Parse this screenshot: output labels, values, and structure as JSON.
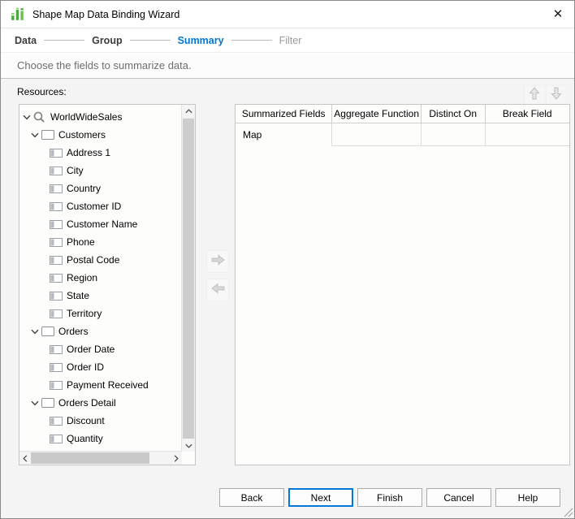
{
  "window": {
    "title": "Shape Map Data Binding Wizard"
  },
  "icons": {
    "close": "✕"
  },
  "colors": {
    "accent_blue": "#0078d7",
    "icon_green_dark": "#49a83e",
    "icon_green_light": "#8fd07f",
    "content_background": "#f3f4f3",
    "panel_background": "#fdfdfc",
    "panel_border": "#c6c6c6"
  },
  "steps": {
    "items": [
      {
        "label": "Data",
        "state": "done"
      },
      {
        "label": "Group",
        "state": "done"
      },
      {
        "label": "Summary",
        "state": "active"
      },
      {
        "label": "Filter",
        "state": "upcoming"
      }
    ]
  },
  "subtitle": "Choose the fields to summarize data.",
  "resources": {
    "label": "Resources:",
    "tree": [
      {
        "label": "WorldWideSales",
        "level": 0,
        "icon": "search",
        "expanded": true
      },
      {
        "label": "Customers",
        "level": 1,
        "icon": "dataset",
        "expanded": true
      },
      {
        "label": "Address 1",
        "level": 2,
        "icon": "field"
      },
      {
        "label": "City",
        "level": 2,
        "icon": "field"
      },
      {
        "label": "Country",
        "level": 2,
        "icon": "field"
      },
      {
        "label": "Customer ID",
        "level": 2,
        "icon": "field"
      },
      {
        "label": "Customer Name",
        "level": 2,
        "icon": "field"
      },
      {
        "label": "Phone",
        "level": 2,
        "icon": "field"
      },
      {
        "label": "Postal Code",
        "level": 2,
        "icon": "field"
      },
      {
        "label": "Region",
        "level": 2,
        "icon": "field"
      },
      {
        "label": "State",
        "level": 2,
        "icon": "field"
      },
      {
        "label": "Territory",
        "level": 2,
        "icon": "field"
      },
      {
        "label": "Orders",
        "level": 1,
        "icon": "dataset",
        "expanded": true
      },
      {
        "label": "Order Date",
        "level": 2,
        "icon": "field"
      },
      {
        "label": "Order ID",
        "level": 2,
        "icon": "field"
      },
      {
        "label": "Payment Received",
        "level": 2,
        "icon": "field"
      },
      {
        "label": "Orders Detail",
        "level": 1,
        "icon": "dataset",
        "expanded": true
      },
      {
        "label": "Discount",
        "level": 2,
        "icon": "field"
      },
      {
        "label": "Quantity",
        "level": 2,
        "icon": "field"
      }
    ]
  },
  "summary_table": {
    "columns": [
      "Summarized Fields",
      "Aggregate Function",
      "Distinct On",
      "Break Field"
    ],
    "rows": [
      {
        "cells": [
          "Map",
          "",
          "",
          ""
        ]
      }
    ]
  },
  "footer": {
    "buttons": [
      "Back",
      "Next",
      "Finish",
      "Cancel",
      "Help"
    ],
    "default_button": "Next"
  }
}
